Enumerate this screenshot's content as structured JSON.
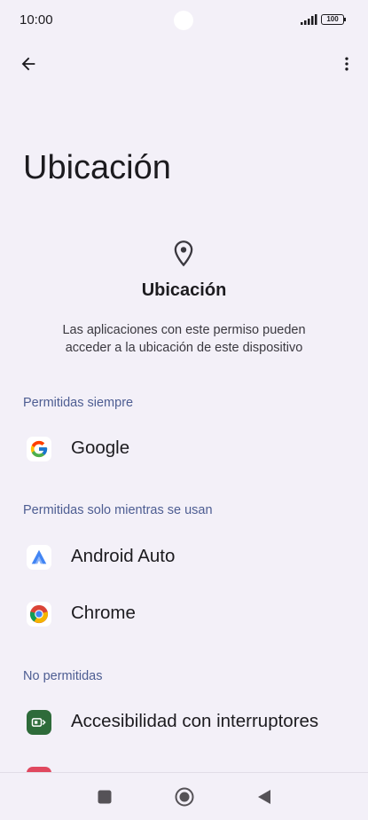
{
  "status": {
    "time": "10:00",
    "battery": "100"
  },
  "page": {
    "title": "Ubicación"
  },
  "header": {
    "icon": "location-pin-icon",
    "title": "Ubicación",
    "description": "Las aplicaciones con este permiso pueden acceder a la ubicación de este dispositivo"
  },
  "sections": {
    "always": {
      "label": "Permitidas siempre",
      "apps": [
        {
          "name": "Google",
          "icon": "google-icon"
        }
      ]
    },
    "while_using": {
      "label": "Permitidas solo mientras se usan",
      "apps": [
        {
          "name": "Android Auto",
          "icon": "android-auto-icon"
        },
        {
          "name": "Chrome",
          "icon": "chrome-icon"
        }
      ]
    },
    "denied": {
      "label": "No permitidas",
      "apps": [
        {
          "name": "Accesibilidad con interruptores",
          "icon": "switch-access-icon"
        }
      ]
    }
  },
  "colors": {
    "background": "#f3f0f8",
    "section_header": "#4d5d92",
    "text": "#1c1b1f"
  }
}
